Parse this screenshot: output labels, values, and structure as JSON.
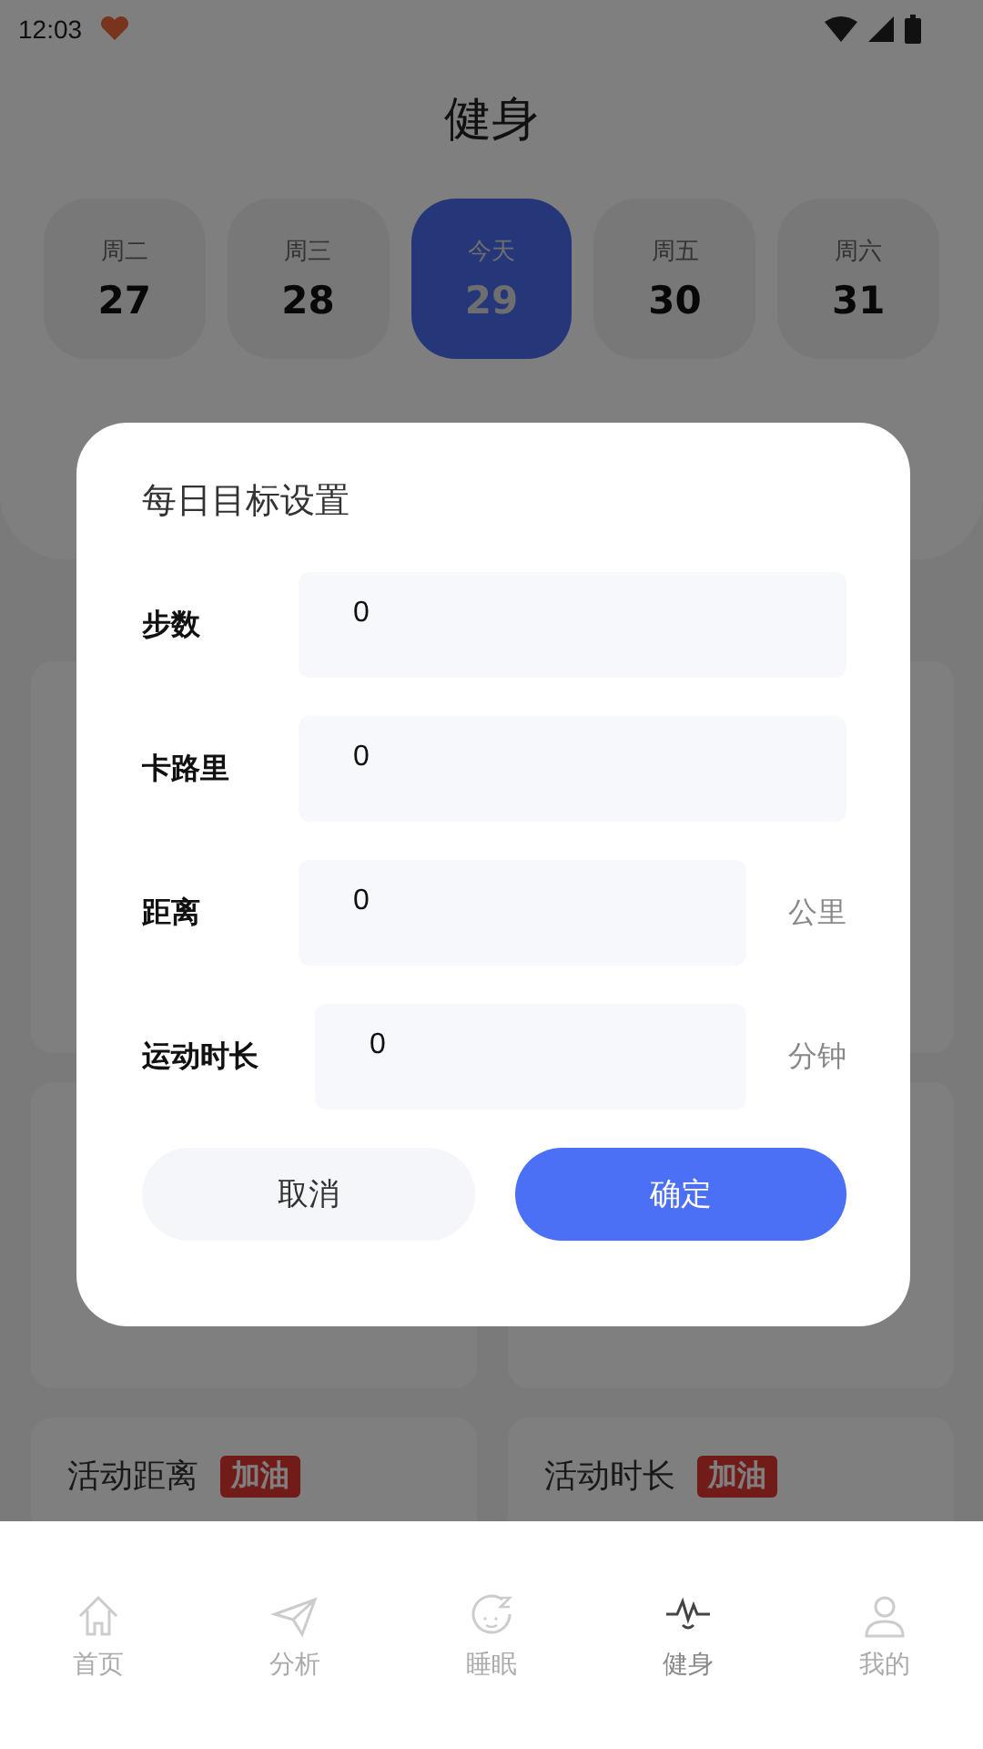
{
  "status_bar": {
    "time": "12:03"
  },
  "header": {
    "title": "健身"
  },
  "days": [
    {
      "weekday": "周二",
      "date": "27",
      "selected": false
    },
    {
      "weekday": "周三",
      "date": "28",
      "selected": false
    },
    {
      "weekday": "今天",
      "date": "29",
      "selected": true
    },
    {
      "weekday": "周五",
      "date": "30",
      "selected": false
    },
    {
      "weekday": "周六",
      "date": "31",
      "selected": false
    }
  ],
  "cards": [
    {
      "title": "活动距离",
      "badge": "加油"
    },
    {
      "title": "活动时长",
      "badge": "加油"
    }
  ],
  "dialog": {
    "title": "每日目标设置",
    "fields": [
      {
        "label": "步数",
        "value": "0"
      },
      {
        "label": "卡路里",
        "value": "0"
      },
      {
        "label": "距离",
        "value": "0",
        "unit": "公里"
      },
      {
        "label": "运动时长",
        "value": "0",
        "unit": "分钟"
      }
    ],
    "buttons": [
      {
        "label": "取消",
        "kind": "secondary"
      },
      {
        "label": "确定",
        "kind": "primary"
      }
    ]
  },
  "tab_bar": [
    {
      "label": "首页",
      "selected": false
    },
    {
      "label": "分析",
      "selected": false
    },
    {
      "label": "睡眠",
      "selected": false
    },
    {
      "label": "健身",
      "selected": true
    },
    {
      "label": "我的",
      "selected": false
    }
  ]
}
